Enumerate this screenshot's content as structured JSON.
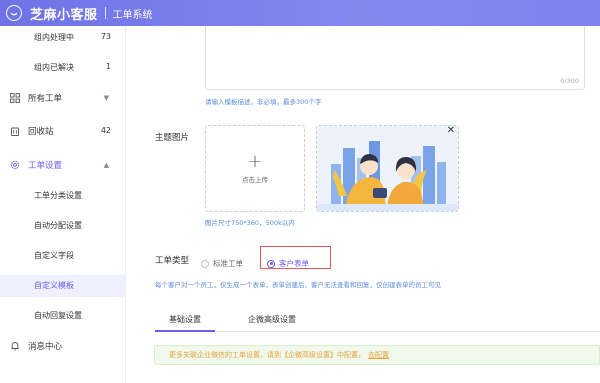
{
  "header": {
    "brand": "芝麻小客服",
    "system": "工单系统"
  },
  "sidebar": {
    "top_items": [
      {
        "label": "组内处理中",
        "count": "73"
      },
      {
        "label": "组内已解决",
        "count": "1"
      }
    ],
    "all_tickets": "所有工单",
    "recycle": {
      "label": "回收站",
      "count": "42"
    },
    "settings": "工单设置",
    "settings_items": [
      "工单分类设置",
      "自动分配设置",
      "自定义字段",
      "自定义模板",
      "自动回复设置"
    ],
    "messages": "消息中心"
  },
  "form": {
    "description_counter": "0/300",
    "description_hint": "请输入模板描述，非必填，最多300个字",
    "theme_image_label": "主题图片",
    "upload_text": "点击上传",
    "image_hint": "图片尺寸750*360，500k以内",
    "ticket_type_label": "工单类型",
    "ticket_type_options": [
      "标准工单",
      "客户表单"
    ],
    "ticket_type_selected": "客户表单",
    "ticket_type_hint": "每个客户对一个员工，仅生成一个表单，表单创建后，客户无法查看和回复，仅创建表单的员工可见"
  },
  "tabs": [
    "基础设置",
    "企微高级设置"
  ],
  "notice": {
    "text": "更多关联企业微信的工单设置，请到【企微高级设置】中配置，",
    "link": "去配置"
  },
  "colors": {
    "accent": "#6a5cf0",
    "header": "#7a7ee9",
    "hint": "#5b8cd6",
    "notice_text": "#e6a23c"
  }
}
